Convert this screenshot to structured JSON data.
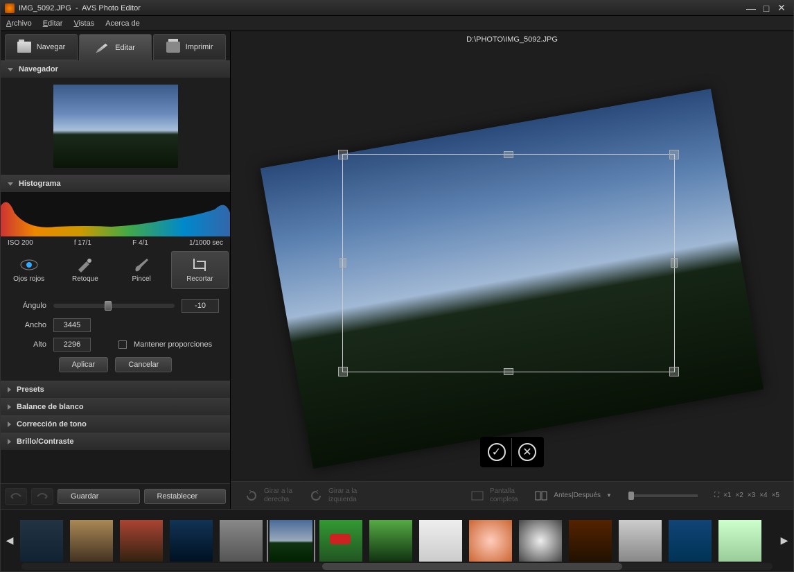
{
  "window": {
    "title_file": "IMG_5092.JPG",
    "title_app": "AVS Photo Editor"
  },
  "menu": {
    "archivo": "Archivo",
    "editar": "Editar",
    "vistas": "Vistas",
    "acerca": "Acerca de"
  },
  "modes": {
    "navegar": "Navegar",
    "editar": "Editar",
    "imprimir": "Imprimir"
  },
  "panels": {
    "navegador": "Navegador",
    "histograma": "Histograma",
    "presets": "Presets",
    "balance": "Balance de blanco",
    "tono": "Corrección de tono",
    "brillo": "Brillo/Contraste"
  },
  "meta": {
    "iso": "ISO 200",
    "f1": "f 17/1",
    "f2": "F 4/1",
    "shutter": "1/1000 sec"
  },
  "tools": {
    "ojos": "Ojos rojos",
    "retoque": "Retoque",
    "pincel": "Pincel",
    "recortar": "Recortar"
  },
  "crop": {
    "angulo_label": "Ángulo",
    "angulo": "-10",
    "ancho_label": "Ancho",
    "ancho": "3445",
    "alto_label": "Alto",
    "alto": "2296",
    "mantener": "Mantener proporciones",
    "aplicar": "Aplicar",
    "cancelar": "Cancelar"
  },
  "actions": {
    "guardar": "Guardar",
    "restablecer": "Restablecer"
  },
  "filepath": "D:\\PHOTO\\IMG_5092.JPG",
  "toolbar": {
    "girar_derecha": "Girar a la\nderecha",
    "girar_izquierda": "Girar a la\nizquierda",
    "pantalla": "Pantalla\ncompleta",
    "antes_despues": "Antes|Después",
    "zoom_fit": "⛶",
    "zooms": [
      "×1",
      "×2",
      "×3",
      "×4",
      "×5"
    ]
  }
}
